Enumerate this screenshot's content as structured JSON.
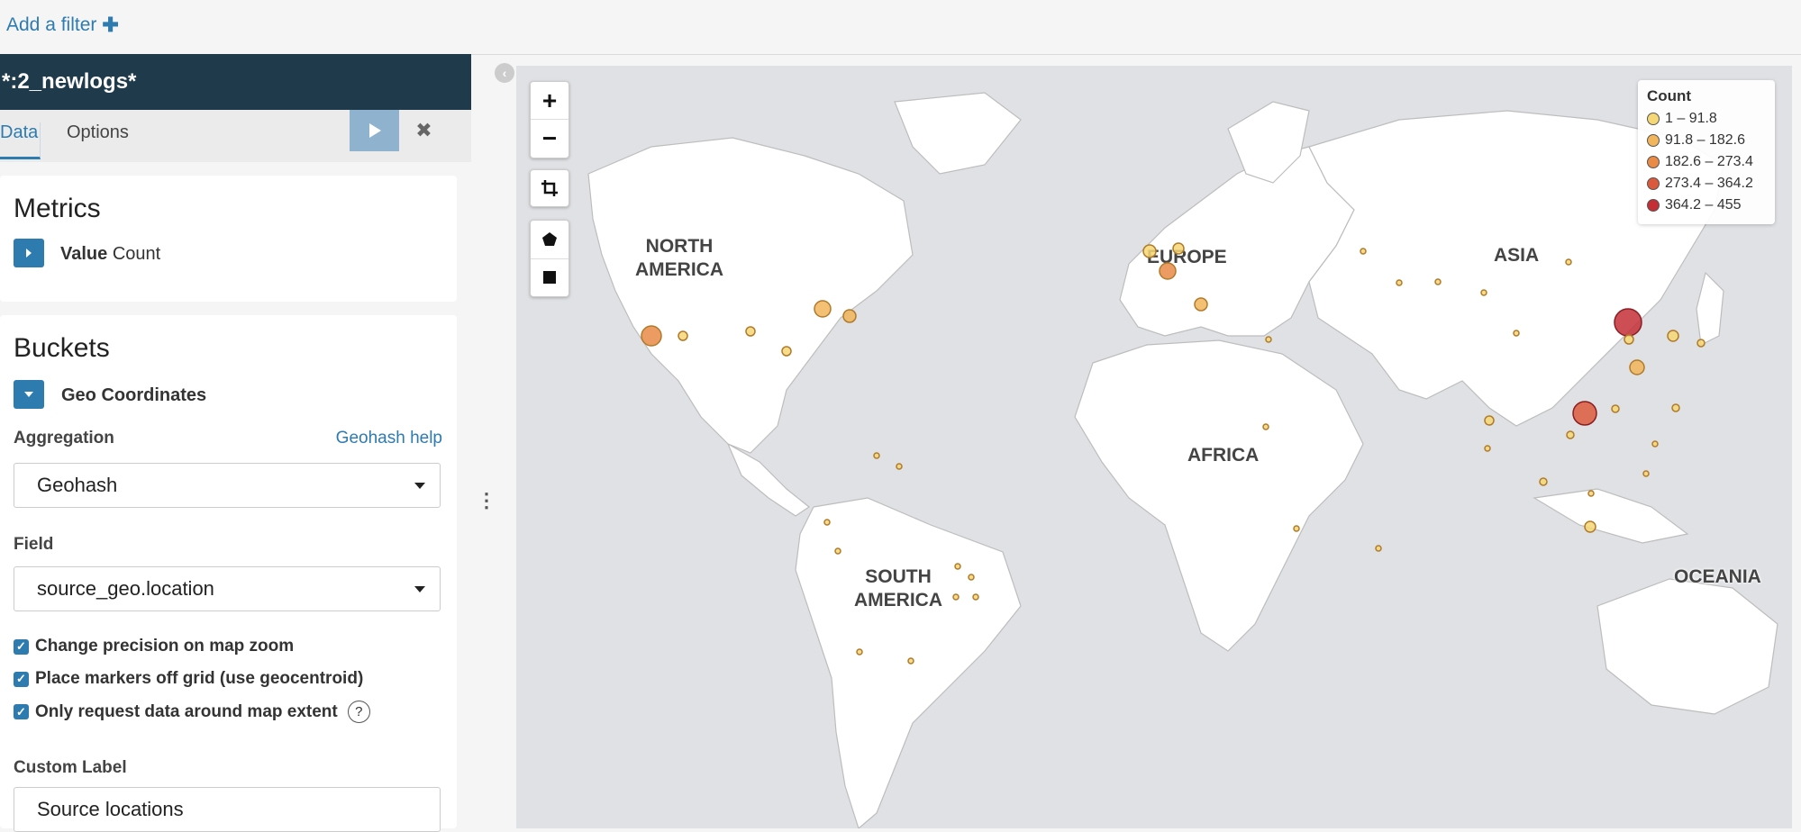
{
  "filter_bar": {
    "add_filter_label": "Add a filter",
    "plus_icon": "plus-icon"
  },
  "sidebar": {
    "index_pattern": "*:2_newlogs*",
    "tabs": [
      {
        "label": "Data"
      },
      {
        "label": "Options"
      }
    ],
    "apply_icon": "play-icon",
    "discard_icon": "close-icon",
    "metrics": {
      "title": "Metrics",
      "agg_label": "Value",
      "agg_type": "Count"
    },
    "buckets": {
      "title": "Buckets",
      "agg_name": "Geo Coordinates",
      "aggregation_label": "Aggregation",
      "help_link": "Geohash help",
      "aggregation_value": "Geohash",
      "field_label": "Field",
      "field_value": "source_geo.location",
      "checkboxes": [
        {
          "label": "Change precision on map zoom",
          "checked": true
        },
        {
          "label": "Place markers off grid (use geocentroid)",
          "checked": true
        },
        {
          "label": "Only request data around map extent",
          "checked": true
        }
      ],
      "custom_label_label": "Custom Label",
      "custom_label_value": "Source locations"
    }
  },
  "map": {
    "region_labels": {
      "north_america": "NORTH\nAMERICA",
      "south_america": "SOUTH\nAMERICA",
      "europe": "EUROPE",
      "asia": "ASIA",
      "africa": "AFRICA",
      "oceania": "OCEANIA"
    },
    "controls": {
      "zoom_in": "+",
      "zoom_out": "−",
      "fit_icon": "crop-icon",
      "polygon_icon": "polygon-icon",
      "rectangle_icon": "rectangle-icon"
    },
    "legend": {
      "title": "Count",
      "ranges": [
        {
          "label": "1 – 91.8",
          "color": "#f6d776"
        },
        {
          "label": "91.8 – 182.6",
          "color": "#f2b55a"
        },
        {
          "label": "182.6 – 273.4",
          "color": "#e98b46"
        },
        {
          "label": "273.4 – 364.2",
          "color": "#dc5a3c"
        },
        {
          "label": "364.2 – 455",
          "color": "#c42f36"
        }
      ]
    }
  }
}
